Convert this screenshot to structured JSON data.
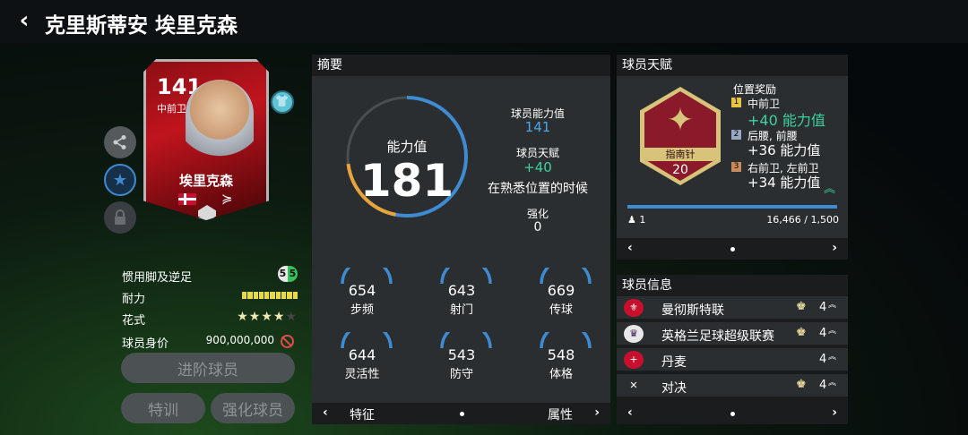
{
  "header": {
    "title": "克里斯蒂安 埃里克森",
    "back_icon": "‹"
  },
  "card": {
    "rating": "141",
    "position": "中前卫",
    "name": "埃里克森",
    "club_logo": "≽",
    "nation_icon": "denmark-flag-icon"
  },
  "side_buttons": {
    "share": "share-icon",
    "favorite": "star-icon",
    "lock": "lock-icon",
    "shirt": "shirt-icon"
  },
  "attributes": {
    "weak_foot_label": "惯用脚及逆足",
    "weak_foot_left": "5",
    "weak_foot_right": "5",
    "stamina_label": "耐力",
    "stamina_segments": 10,
    "skills_label": "花式",
    "skills_stars": 4,
    "skills_total": 5,
    "value_label": "球员身价",
    "value": "900,000,000"
  },
  "buttons": {
    "advance": "进阶球员",
    "training": "特训",
    "enhance": "强化球员"
  },
  "summary": {
    "title": "摘要",
    "ring_label": "能力值",
    "ring_value": "181",
    "ring_fraction": 0.78,
    "ability_label": "球员能力值",
    "ability_value": "141",
    "talent_label": "球员天赋",
    "talent_value": "+40",
    "talent_desc": "在熟悉位置的时候",
    "enhance_label": "强化",
    "enhance_value": "0",
    "stats": [
      {
        "value": "654",
        "label": "步频"
      },
      {
        "value": "643",
        "label": "射门"
      },
      {
        "value": "669",
        "label": "传球"
      },
      {
        "value": "644",
        "label": "灵活性"
      },
      {
        "value": "543",
        "label": "防守"
      },
      {
        "value": "548",
        "label": "体格"
      }
    ],
    "foot_left": "特征",
    "foot_right": "属性"
  },
  "talent": {
    "title": "球员天赋",
    "badge_name": "指南针",
    "badge_level": "20",
    "bonus_title": "位置奖励",
    "bonuses": [
      {
        "rank": "1",
        "positions": "中前卫",
        "value": "+40 能力值"
      },
      {
        "rank": "2",
        "positions": "后腰, 前腰",
        "value": "+36 能力值"
      },
      {
        "rank": "3",
        "positions": "右前卫, 左前卫",
        "value": "+34 能力值"
      }
    ],
    "progress_level": "1",
    "progress_text": "16,466 / 1,500",
    "progress_fraction": 1.0
  },
  "info": {
    "title": "球员信息",
    "rows": [
      {
        "text": "曼彻斯特联",
        "level": "4",
        "icon": "man-utd-crest-icon"
      },
      {
        "text": "英格兰足球超级联赛",
        "level": "4",
        "icon": "premier-league-icon"
      },
      {
        "text": "丹麦",
        "level": "4",
        "icon": "denmark-flag-icon"
      },
      {
        "text": "对决",
        "level": "4",
        "icon": "showdown-icon"
      }
    ]
  },
  "colors": {
    "accent_blue": "#3e8bd1",
    "accent_green": "#3fd0a0",
    "card_red": "#c0141d",
    "gold": "#d8c37a"
  }
}
